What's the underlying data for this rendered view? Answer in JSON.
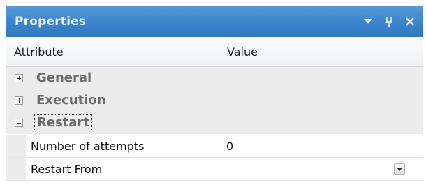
{
  "panel": {
    "title": "Properties",
    "accent_color": "#3f87cd",
    "title_buttons": [
      {
        "icon": "dropdown-arrow-icon"
      },
      {
        "icon": "pin-icon"
      },
      {
        "icon": "close-icon"
      }
    ]
  },
  "grid": {
    "headers": {
      "attribute": "Attribute",
      "value": "Value"
    },
    "categories": [
      {
        "label": "General",
        "expanded": false
      },
      {
        "label": "Execution",
        "expanded": false
      },
      {
        "label": "Restart",
        "expanded": true,
        "selected": true
      }
    ],
    "properties": [
      {
        "name": "Number of attempts",
        "value": "0"
      },
      {
        "name": "Restart From",
        "value": ""
      }
    ]
  }
}
